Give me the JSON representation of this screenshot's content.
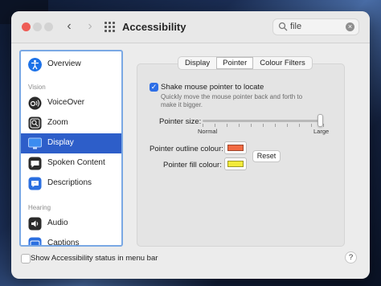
{
  "window": {
    "title": "Accessibility"
  },
  "search": {
    "value": "file"
  },
  "sidebar": {
    "items": [
      {
        "label": "Overview",
        "icon": "accessibility-icon"
      },
      {
        "label": "VoiceOver",
        "icon": "voiceover-icon"
      },
      {
        "label": "Zoom",
        "icon": "zoom-icon"
      },
      {
        "label": "Display",
        "icon": "display-icon",
        "selected": true
      },
      {
        "label": "Spoken Content",
        "icon": "speech-bubble-icon"
      },
      {
        "label": "Descriptions",
        "icon": "descriptions-icon"
      },
      {
        "label": "Audio",
        "icon": "speaker-icon"
      },
      {
        "label": "Captions",
        "icon": "captions-icon"
      }
    ],
    "sections": {
      "vision": "Vision",
      "hearing": "Hearing"
    }
  },
  "tabs": [
    {
      "label": "Display"
    },
    {
      "label": "Pointer",
      "active": true
    },
    {
      "label": "Colour Filters"
    }
  ],
  "pointer": {
    "shake_label": "Shake mouse pointer to locate",
    "shake_checked": true,
    "shake_help": "Quickly move the mouse pointer back and forth to make it bigger.",
    "size_label": "Pointer size:",
    "size_min_label": "Normal",
    "size_max_label": "Large",
    "size_value_fraction": 0.98,
    "outline_label": "Pointer outline colour:",
    "outline_color": "#f26b43",
    "fill_label": "Pointer fill colour:",
    "fill_color": "#f2ea3a",
    "reset_label": "Reset"
  },
  "footer": {
    "status_label": "Show Accessibility status in menu bar",
    "status_checked": false,
    "help_label": "?"
  },
  "colors": {
    "accent": "#2d5ec9",
    "checkbox": "#2d6ee6"
  }
}
